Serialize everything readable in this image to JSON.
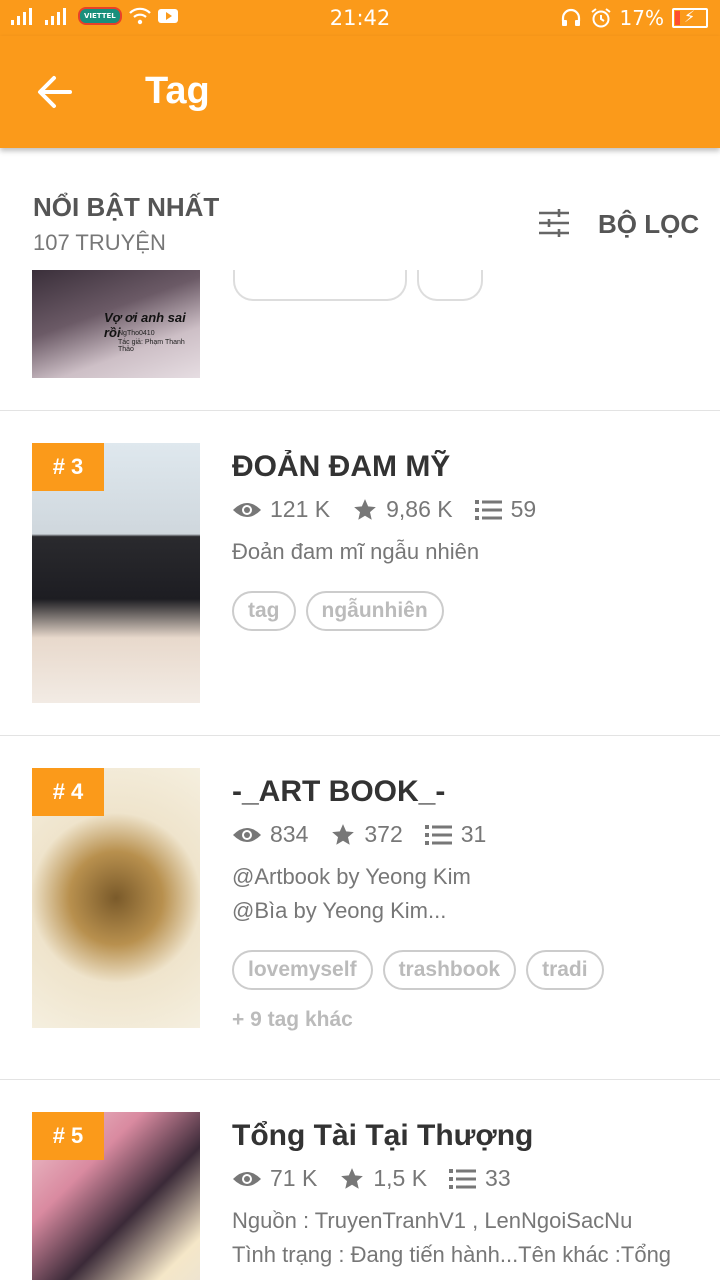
{
  "status_bar": {
    "carrier": "VIETTEL",
    "time": "21:42",
    "battery": "17%"
  },
  "app_bar": {
    "title": "Tag"
  },
  "sort": {
    "title": "NỔI BẬT NHẤT",
    "count": "107 TRUYỆN",
    "filter_label": "BỘ LỌC"
  },
  "partial_item": {
    "cover_text": "Vợ ơi anh sai rồi",
    "cover_sub1": "NgTho0410",
    "cover_sub2": "Tác giả: Phạm Thanh Thảo"
  },
  "stories": [
    {
      "rank": "# 3",
      "title": "ĐOẢN ĐAM MỸ",
      "views": "121 K",
      "votes": "9,86 K",
      "parts": "59",
      "desc1": "Đoản đam mĩ ngẫu nhiên",
      "tags": [
        "tag",
        "ngẫunhiên"
      ]
    },
    {
      "rank": "# 4",
      "title": "-_ART BOOK_-",
      "views": "834",
      "votes": "372",
      "parts": "31",
      "desc1": "@Artbook by Yeong Kim",
      "desc2": "@Bìa by Yeong Kim...",
      "tags": [
        "lovemyself",
        "trashbook",
        "tradi"
      ],
      "more_tags": "+ 9 tag khác"
    },
    {
      "rank": "# 5",
      "title": "Tổng Tài Tại Thượng",
      "views": "71 K",
      "votes": "1,5 K",
      "parts": "33",
      "desc1": "Nguồn : TruyenTranhV1 , LenNgoiSacNu",
      "desc2": "Tình trạng : Đang tiến hành...Tên khác :Tổng"
    }
  ]
}
